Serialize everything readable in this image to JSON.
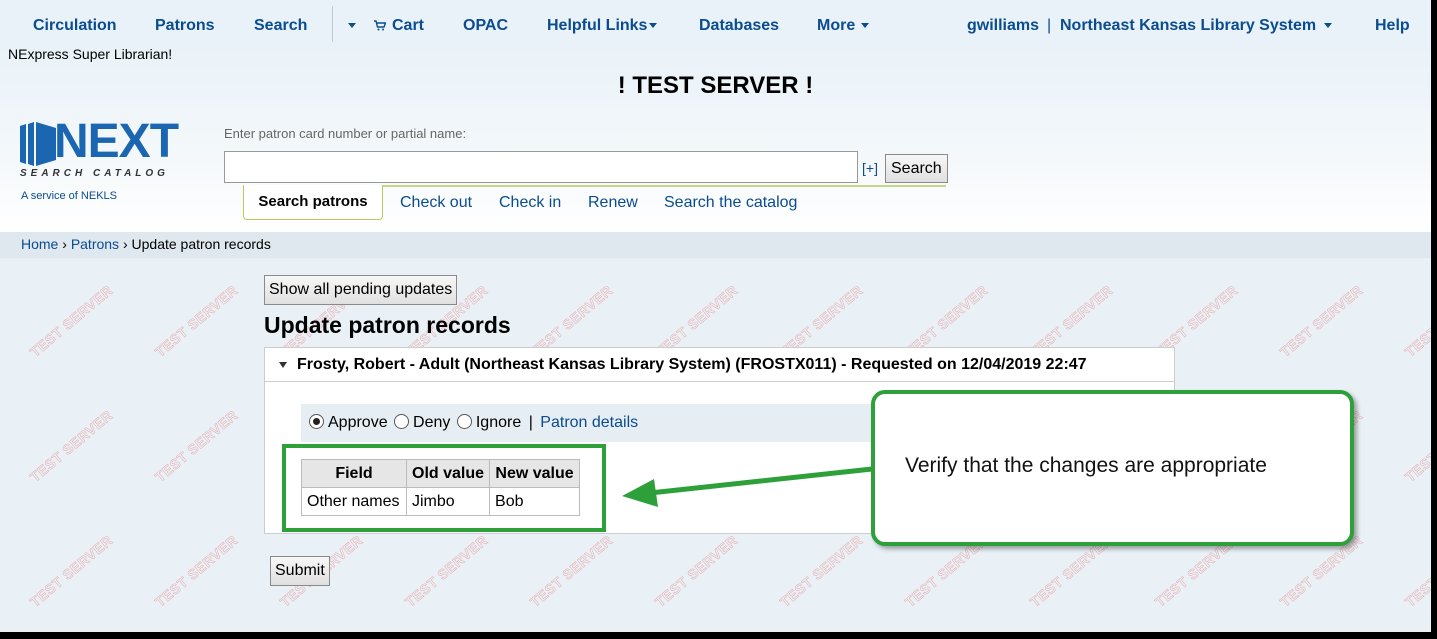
{
  "nav": {
    "circulation": "Circulation",
    "patrons": "Patrons",
    "search": "Search",
    "cart": "Cart",
    "opac": "OPAC",
    "helpful_links": "Helpful Links",
    "databases": "Databases",
    "more": "More",
    "user": "gwilliams",
    "separator": "|",
    "library": "Northeast Kansas Library System",
    "help": "Help"
  },
  "header": {
    "super_librarian": "NExpress Super Librarian!",
    "test_server": "! TEST SERVER !",
    "logo_main": "NEXT",
    "logo_sub": "SEARCH CATALOG",
    "logo_service": "A service of NEKLS",
    "colors": {
      "logo_blue": "#1a66b0",
      "link": "#0a4c8f"
    }
  },
  "search": {
    "label": "Enter patron card number or partial name:",
    "value": "",
    "plus": "[+]",
    "button": "Search"
  },
  "tabs": {
    "search_patrons": "Search patrons",
    "check_out": "Check out",
    "check_in": "Check in",
    "renew": "Renew",
    "search_catalog": "Search the catalog"
  },
  "breadcrumb": {
    "home": "Home",
    "sep1": "›",
    "patrons": "Patrons",
    "sep2": "›",
    "current": "Update patron records"
  },
  "watermark_text": "TEST SERVER",
  "main": {
    "show_pending": "Show all pending updates",
    "title": "Update patron records",
    "record_header": "Frosty, Robert - Adult (Northeast Kansas Library System) (FROSTX011) - Requested on 12/04/2019 22:47",
    "actions": {
      "approve": "Approve",
      "deny": "Deny",
      "ignore": "Ignore",
      "separator": "|",
      "patron_details": "Patron details",
      "selected": "approve"
    },
    "table": {
      "headers": [
        "Field",
        "Old value",
        "New value"
      ],
      "rows": [
        [
          "Other names",
          "Jimbo",
          "Bob"
        ]
      ]
    },
    "submit": "Submit"
  },
  "annotation": {
    "callout_text": "Verify that the changes are appropriate",
    "color": "#2da03a"
  }
}
